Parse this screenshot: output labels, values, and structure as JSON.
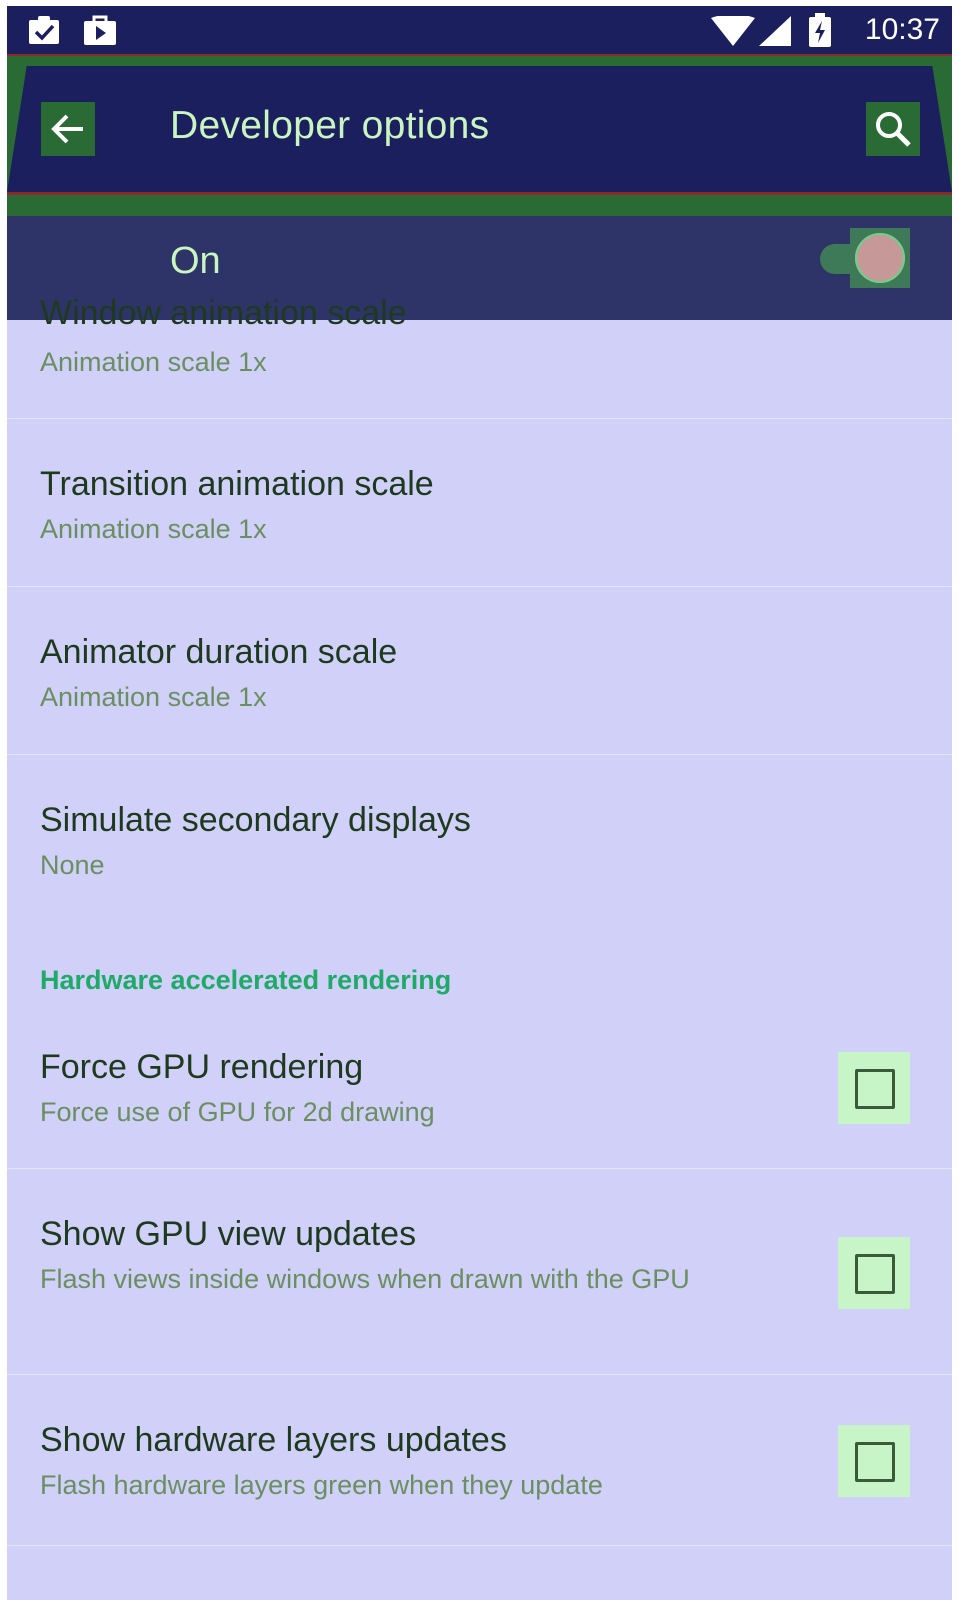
{
  "status_bar": {
    "time": "10:37",
    "left_icons": [
      "clipboard-check-icon",
      "play-store-icon"
    ],
    "right_icons": [
      "wifi-icon",
      "cell-signal-icon",
      "battery-charging-icon"
    ]
  },
  "action_bar": {
    "title": "Developer options",
    "back_icon": "arrow-back-icon",
    "search_icon": "search-icon"
  },
  "master_switch": {
    "label": "On",
    "checked": true
  },
  "items": [
    {
      "title": "Window animation scale",
      "summary": "Animation scale 1x"
    },
    {
      "title": "Transition animation scale",
      "summary": "Animation scale 1x"
    },
    {
      "title": "Animator duration scale",
      "summary": "Animation scale 1x"
    },
    {
      "title": "Simulate secondary displays",
      "summary": "None"
    }
  ],
  "category": "Hardware accelerated rendering",
  "checkbox_items": [
    {
      "title": "Force GPU rendering",
      "summary": "Force use of GPU for 2d drawing",
      "checked": false
    },
    {
      "title": "Show GPU view updates",
      "summary": "Flash views inside windows when drawn with the GPU",
      "checked": false
    },
    {
      "title": "Show hardware layers updates",
      "summary": "Flash hardware layers green when they update",
      "checked": false
    }
  ],
  "colors": {
    "toolbar": "#1b1f5e",
    "switch_bar": "#2e3468",
    "background": "#d0d0f8",
    "accent": "#1faa6a"
  }
}
